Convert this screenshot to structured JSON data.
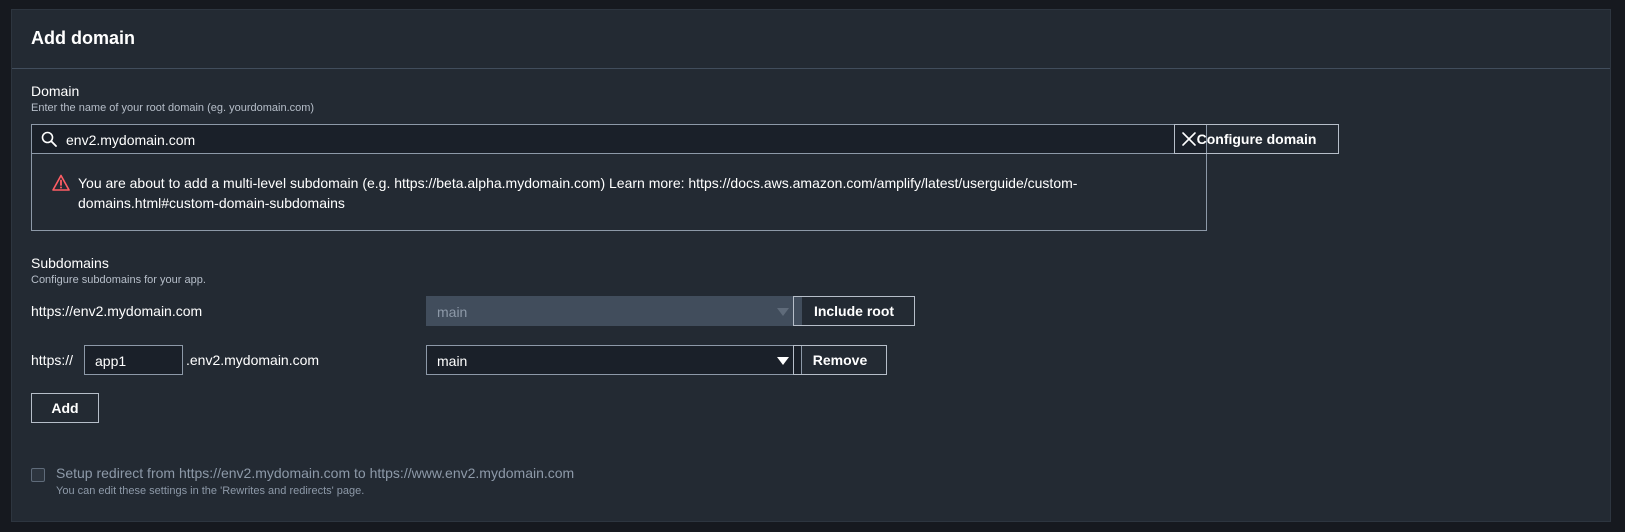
{
  "panel": {
    "title": "Add domain"
  },
  "domain": {
    "label": "Domain",
    "description": "Enter the name of your root domain (eg. yourdomain.com)",
    "value": "env2.mydomain.com",
    "configure_label": "Configure domain",
    "alert": "You are about to add a multi-level subdomain (e.g. https://beta.alpha.mydomain.com) Learn more: https://docs.aws.amazon.com/amplify/latest/userguide/custom-domains.html#custom-domain-subdomains"
  },
  "subdomains": {
    "label": "Subdomains",
    "description": "Configure subdomains for your app.",
    "root_row": {
      "url": "https://env2.mydomain.com",
      "branch": "main",
      "action_label": "Include root"
    },
    "sub_row": {
      "prefix": "https://",
      "value": "app1",
      "suffix": ".env2.mydomain.com",
      "branch": "main",
      "action_label": "Remove"
    },
    "add_label": "Add"
  },
  "redirect": {
    "label": "Setup redirect from https://env2.mydomain.com to https://www.env2.mydomain.com",
    "description": "You can edit these settings in the 'Rewrites and redirects' page.",
    "checked": false
  },
  "colors": {
    "background": "#16191f",
    "panel": "#232a33",
    "warning": "#ff5d64"
  },
  "icons": [
    "search-icon",
    "clear-icon",
    "warning-icon",
    "caret-down-icon"
  ]
}
